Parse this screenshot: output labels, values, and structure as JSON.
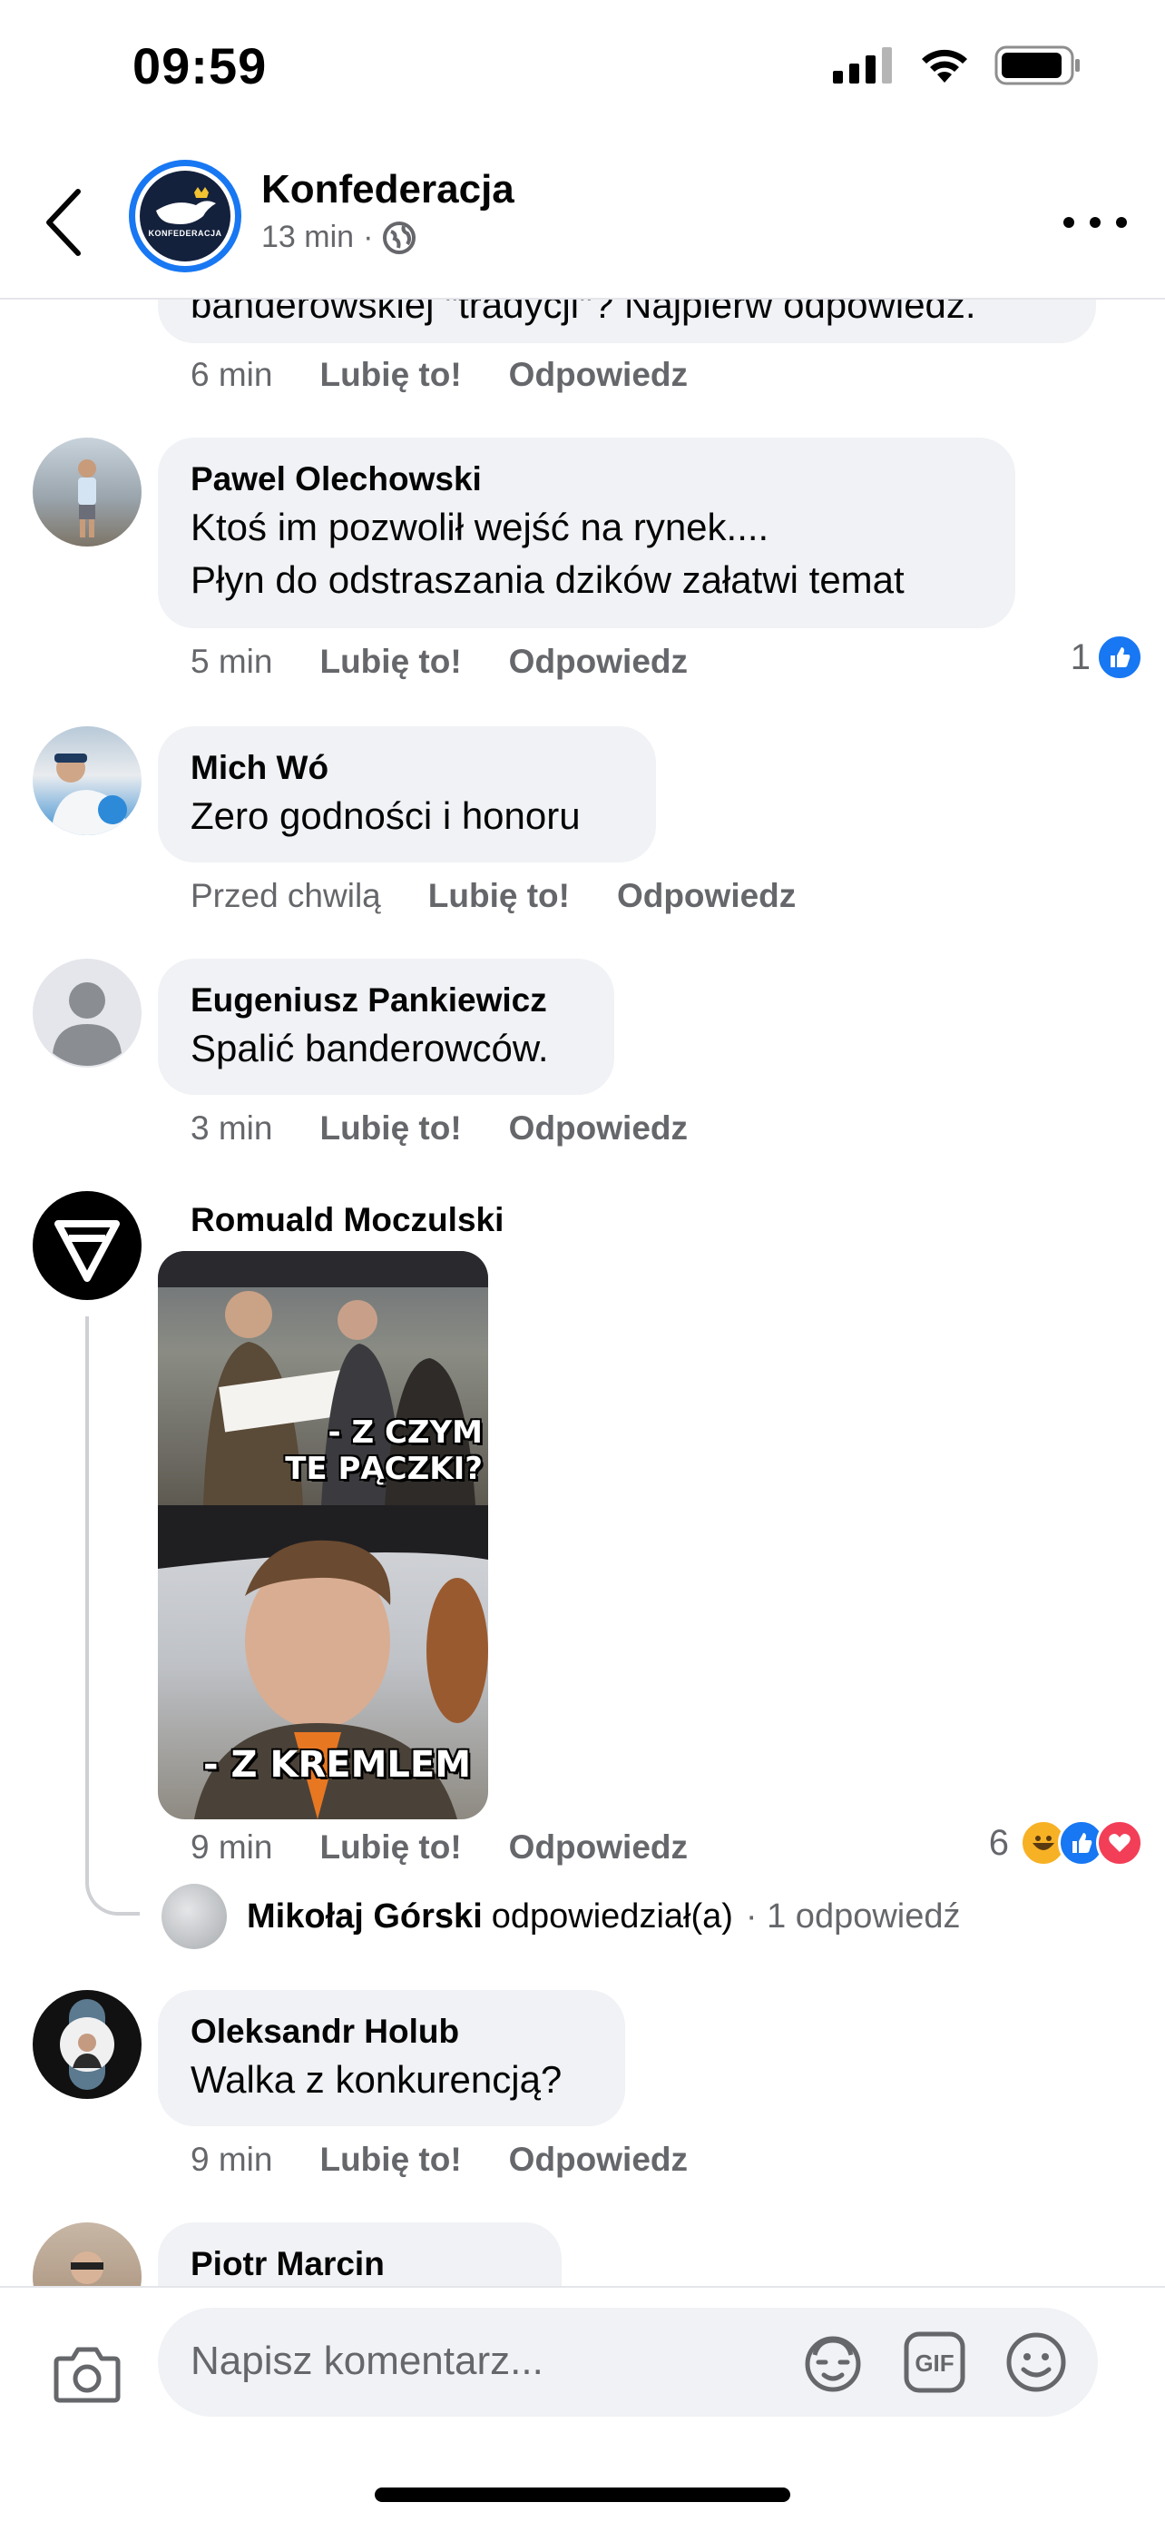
{
  "status_bar": {
    "time": "09:59"
  },
  "header": {
    "page_name": "Konfederacja",
    "time": "13 min",
    "separator": "·",
    "avatar_text": "KONFEDERACJA"
  },
  "partial_comment": {
    "text": "banderowskiej \"tradycji\"? Najpierw odpowiedz.",
    "time": "6 min",
    "like": "Lubię to!",
    "reply": "Odpowiedz"
  },
  "comments": [
    {
      "author": "Pawel Olechowski",
      "lines": [
        "Ktoś im pozwolił wejść na rynek....",
        "Płyn do odstraszania dzików załatwi temat"
      ],
      "time": "5 min",
      "like": "Lubię to!",
      "reply": "Odpowiedz",
      "reaction_count": "1"
    },
    {
      "author": "Mich Wó",
      "lines": [
        "Zero godności i honoru"
      ],
      "time": "Przed chwilą",
      "like": "Lubię to!",
      "reply": "Odpowiedz"
    },
    {
      "author": "Eugeniusz Pankiewicz",
      "lines": [
        "Spalić banderowców."
      ],
      "time": "3 min",
      "like": "Lubię to!",
      "reply": "Odpowiedz"
    },
    {
      "author": "Romuald Moczulski",
      "meme_caption_top_1": "- Z CZYM",
      "meme_caption_top_2": "TE PĄCZKI?",
      "meme_caption_bottom": "- Z KREMLEM",
      "time": "9 min",
      "like": "Lubię to!",
      "reply": "Odpowiedz",
      "reaction_count": "6",
      "reply_preview": {
        "name": "Mikołaj Górski",
        "action": "odpowiedział(a)",
        "meta": "· 1 odpowiedź"
      }
    },
    {
      "author": "Oleksandr Holub",
      "lines": [
        "Walka z konkurencją?"
      ],
      "time": "9 min",
      "like": "Lubię to!",
      "reply": "Odpowiedz"
    },
    {
      "author": "Piotr Marcin"
    }
  ],
  "composer": {
    "placeholder": "Napisz komentarz...",
    "gif_label": "GIF"
  },
  "colors": {
    "fb_blue": "#1877f2",
    "bubble_gray": "#f0f2f5",
    "secondary_text": "#65676b",
    "love_red": "#f33e58",
    "haha_yellow": "#f7b125"
  },
  "icons": [
    "back-chevron-icon",
    "globe-icon",
    "more-dots-icon",
    "like-reaction-icon",
    "haha-reaction-icon",
    "love-reaction-icon",
    "camera-icon",
    "avatar-sticker-icon",
    "gif-icon",
    "emoji-icon",
    "signal-icon",
    "wifi-icon",
    "battery-icon"
  ]
}
